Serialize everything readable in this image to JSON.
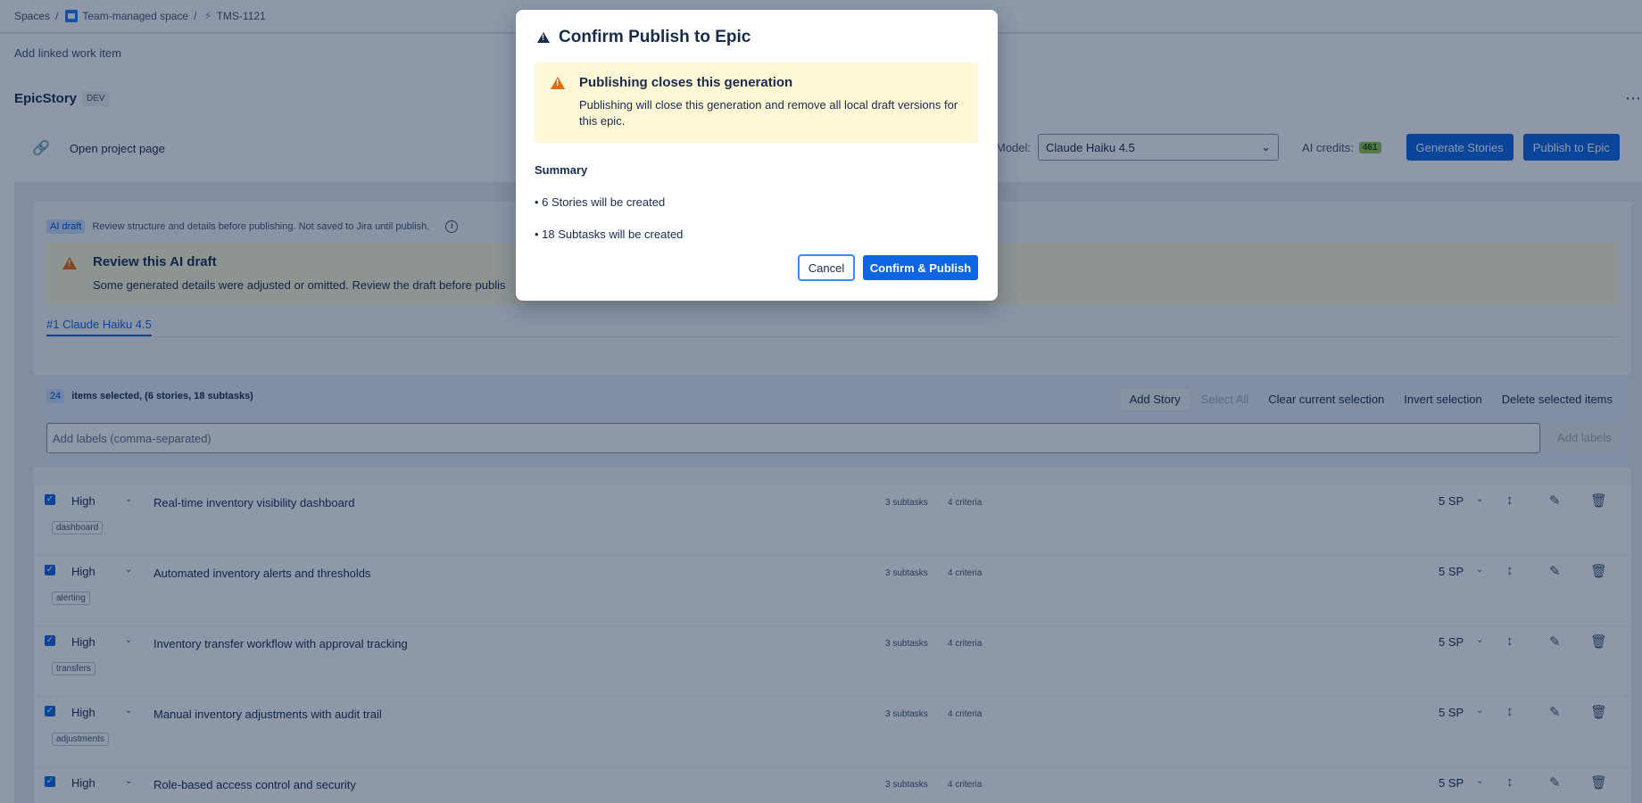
{
  "breadcrumb": {
    "spaces": "Spaces",
    "space": "Team-managed space",
    "issue": "TMS-1121"
  },
  "linked_item": "Add linked work item",
  "app": {
    "title": "EpicStory",
    "env": "DEV"
  },
  "project_link": "Open project page",
  "model": {
    "label": "Model:",
    "value": "Claude Haiku 4.5"
  },
  "credits": {
    "label": "AI credits:",
    "value": "461"
  },
  "actions": {
    "generate": "Generate Stories",
    "publish": "Publish to Epic"
  },
  "ai_note": {
    "tag": "AI draft",
    "text": "Review structure and details before publishing. Not saved to Jira until publish."
  },
  "review": {
    "title": "Review this AI draft",
    "body": "Some generated details were adjusted or omitted. Review the draft before publis"
  },
  "tab": "#1 Claude Haiku 4.5",
  "selection": {
    "count": "24",
    "text": "items selected, (6 stories, 18 subtasks)",
    "add_story": "Add Story",
    "select_all": "Select All",
    "clear": "Clear current selection",
    "invert": "Invert selection",
    "delete": "Delete selected items",
    "labels_placeholder": "Add labels (comma-separated)",
    "add_labels": "Add labels"
  },
  "stories": [
    {
      "priority": "High",
      "title": "Real-time inventory visibility dashboard",
      "subtasks": "3 subtasks",
      "criteria": "4 criteria",
      "points": "5 SP",
      "label": "dashboard"
    },
    {
      "priority": "High",
      "title": "Automated inventory alerts and thresholds",
      "subtasks": "3 subtasks",
      "criteria": "4 criteria",
      "points": "5 SP",
      "label": "alerting"
    },
    {
      "priority": "High",
      "title": "Inventory transfer workflow with approval tracking",
      "subtasks": "3 subtasks",
      "criteria": "4 criteria",
      "points": "5 SP",
      "label": "transfers"
    },
    {
      "priority": "High",
      "title": "Manual inventory adjustments with audit trail",
      "subtasks": "3 subtasks",
      "criteria": "4 criteria",
      "points": "5 SP",
      "label": "adjustments"
    },
    {
      "priority": "High",
      "title": "Role-based access control and security",
      "subtasks": "3 subtasks",
      "criteria": "4 criteria",
      "points": "5 SP",
      "label": ""
    }
  ],
  "modal": {
    "title": "Confirm Publish to Epic",
    "warning_title": "Publishing closes this generation",
    "warning_body": "Publishing will close this generation and remove all local draft versions for this epic.",
    "summary_heading": "Summary",
    "summary_items": [
      "• 6 Stories will be created",
      "• 18 Subtasks will be created"
    ],
    "cancel": "Cancel",
    "confirm": "Confirm & Publish"
  }
}
